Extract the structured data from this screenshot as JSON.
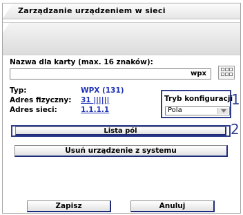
{
  "window": {
    "title": "Zarządzanie urządzeniem w sieci"
  },
  "form": {
    "card_name_label": "Nazwa dla karty (max. 16 znaków):",
    "card_name_value": "",
    "card_name_suffix": "wpx",
    "type_label": "Typ:",
    "type_value": "WPX (131)",
    "physical_address_label": "Adres fizyczny:",
    "physical_address_value": "31 ||||||",
    "network_address_label": "Adres sieci:",
    "network_address_value": "1.1.1.1",
    "config_mode_label": "Tryb konfiguracji",
    "config_mode_value": "Pola"
  },
  "callouts": {
    "one": "1",
    "two": "2"
  },
  "buttons": {
    "field_list": "Lista pól",
    "remove_device": "Usuń urządzenie z systemu",
    "save": "Zapisz",
    "cancel": "Anuluj"
  },
  "icons": {
    "grid": "grid-icon",
    "dropdown": "chevron-down-icon"
  },
  "colors": {
    "value_text": "#1d2fb7",
    "callout_border": "#2e3e8c",
    "button_shadow": "#1f2c7a"
  }
}
